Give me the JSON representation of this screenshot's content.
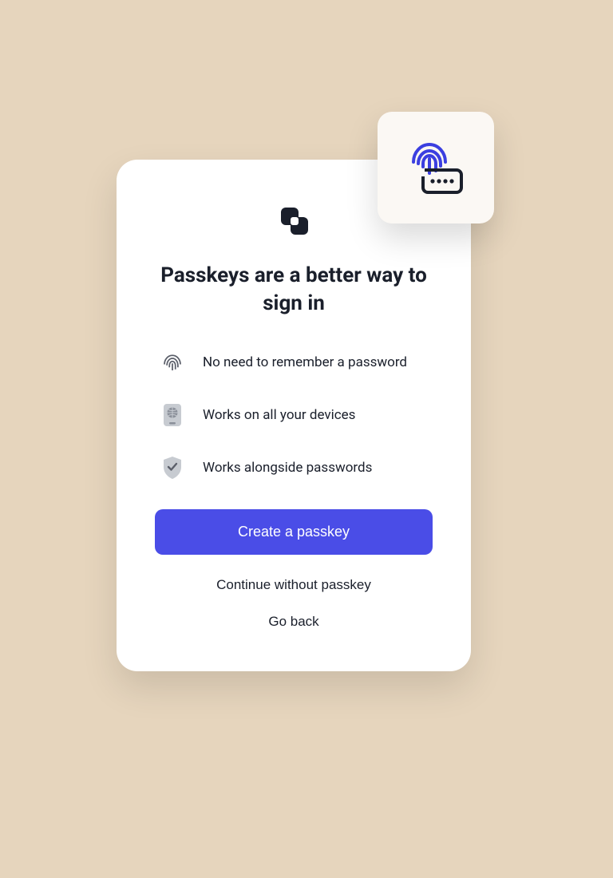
{
  "heading": "Passkeys are a better way to sign in",
  "benefits": [
    {
      "icon": "fingerprint-icon",
      "text": "No need to remember a password"
    },
    {
      "icon": "device-globe-icon",
      "text": "Works on all your devices"
    },
    {
      "icon": "shield-check-icon",
      "text": "Works alongside passwords"
    }
  ],
  "buttons": {
    "primary": "Create a passkey",
    "skip": "Continue without passkey",
    "back": "Go back"
  },
  "colors": {
    "accent": "#4a4de7",
    "background": "#e6d5bd",
    "card": "#ffffff",
    "text": "#1a1f2b"
  }
}
